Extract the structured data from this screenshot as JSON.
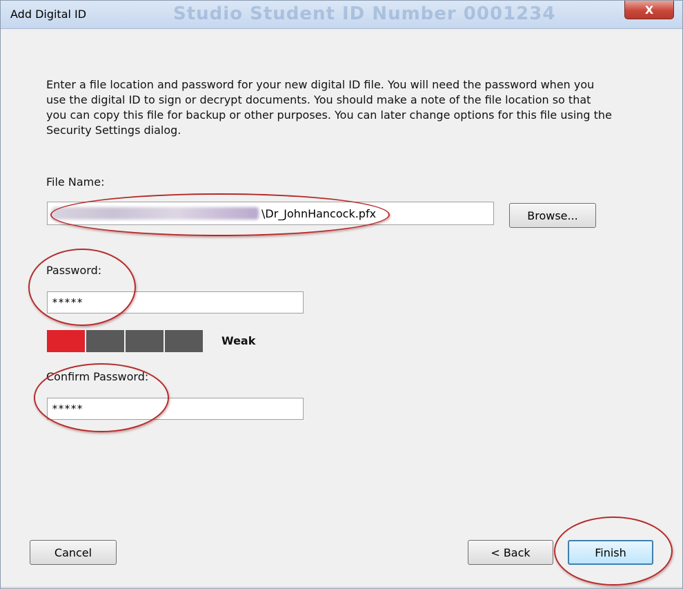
{
  "window": {
    "title": "Add Digital ID",
    "background_title_text": "Studio Student   ID Number 0001234",
    "close_label": "X"
  },
  "intro_text": "Enter a file location and password for your new digital ID file. You will need the password when you use the digital ID to sign or decrypt documents. You should make a note of the file location so that you can copy this file for backup or other purposes. You can later change options for this file using the Security Settings dialog.",
  "file": {
    "label": "File Name:",
    "value_visible": "\\Dr_JohnHancock.pfx",
    "browse_label": "Browse..."
  },
  "password": {
    "label": "Password:",
    "value": "*****",
    "strength_label": "Weak",
    "strength_level": 1,
    "strength_segments": 4
  },
  "confirm_password": {
    "label": "Confirm Password:",
    "value": "*****"
  },
  "buttons": {
    "cancel": "Cancel",
    "back": "< Back",
    "finish": "Finish"
  },
  "colors": {
    "strength_on": "#e0222b",
    "strength_off": "#595959",
    "annotation": "#b52a2a"
  }
}
